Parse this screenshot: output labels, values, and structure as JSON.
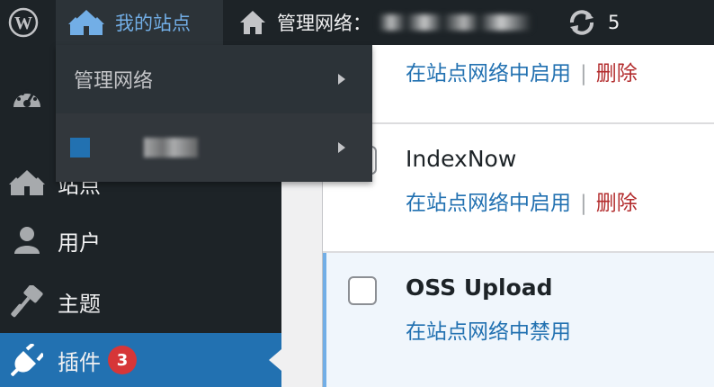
{
  "adminbar": {
    "my_sites_label": "我的站点",
    "network_admin_label": "管理网络：",
    "updates_count": "5",
    "icons": [
      "wordpress-logo-icon",
      "my-sites-icon",
      "home-icon",
      "updates-icon"
    ]
  },
  "dropdown": {
    "items": [
      {
        "label": "管理网络",
        "icon": "chevron-right-icon"
      },
      {
        "label": "",
        "icon": "site-icon"
      }
    ]
  },
  "adminmenu": {
    "items": [
      {
        "label": "",
        "icon": "dashboard-icon"
      },
      {
        "label": "站点",
        "icon": "sites-icon"
      },
      {
        "label": "用户",
        "icon": "users-icon"
      },
      {
        "label": "主题",
        "icon": "themes-icon"
      },
      {
        "label": "插件",
        "icon": "plugins-icon",
        "badge": "3",
        "current": true
      }
    ]
  },
  "plugins": {
    "rows": [
      {
        "name": "",
        "action_primary": "在站点网络中启用",
        "separator": "|",
        "action_delete": "删除"
      },
      {
        "name": "IndexNow",
        "action_primary": "在站点网络中启用",
        "separator": "|",
        "action_delete": "删除"
      },
      {
        "name": "OSS Upload",
        "action_primary": "在站点网络中禁用",
        "active": true
      }
    ]
  },
  "colors": {
    "adminbar_bg": "#1d2327",
    "menu_highlight": "#2271b1",
    "link": "#2271b1",
    "delete": "#b32d2e",
    "badge": "#d63638",
    "active_row_bg": "#f0f6fc"
  }
}
